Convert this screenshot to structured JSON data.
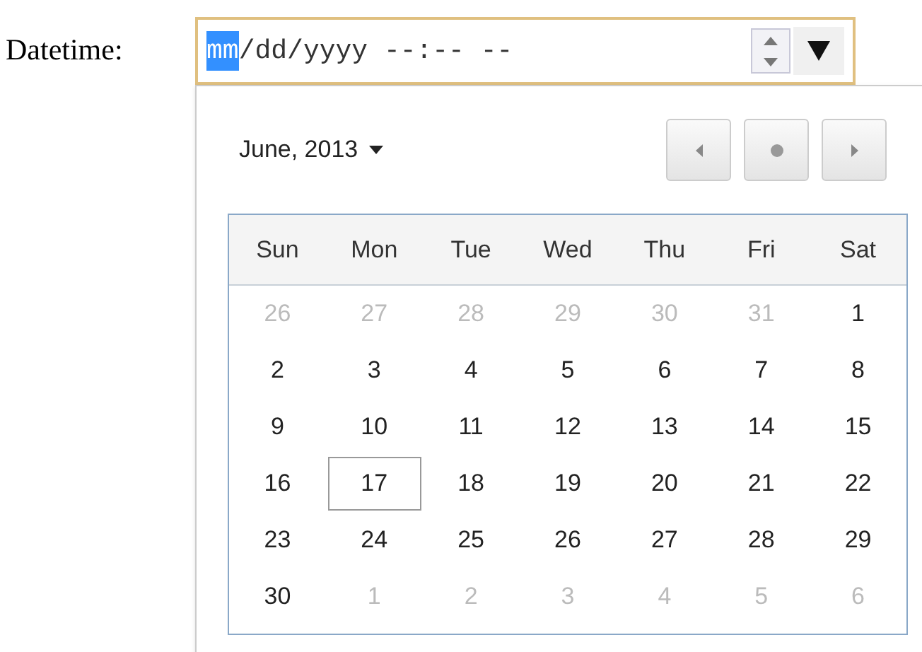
{
  "label": "Datetime:",
  "input": {
    "segments": [
      {
        "text": "mm",
        "selected": true
      },
      {
        "text": "/",
        "selected": false
      },
      {
        "text": "dd",
        "selected": false
      },
      {
        "text": "/",
        "selected": false
      },
      {
        "text": "yyyy",
        "selected": false
      },
      {
        "text": " --:--",
        "selected": false
      },
      {
        "text": " --",
        "selected": false
      }
    ]
  },
  "picker": {
    "month": "June, 2013",
    "weekdays": [
      "Sun",
      "Mon",
      "Tue",
      "Wed",
      "Thu",
      "Fri",
      "Sat"
    ],
    "weeks": [
      [
        {
          "day": "26",
          "outside": true,
          "focused": false
        },
        {
          "day": "27",
          "outside": true,
          "focused": false
        },
        {
          "day": "28",
          "outside": true,
          "focused": false
        },
        {
          "day": "29",
          "outside": true,
          "focused": false
        },
        {
          "day": "30",
          "outside": true,
          "focused": false
        },
        {
          "day": "31",
          "outside": true,
          "focused": false
        },
        {
          "day": "1",
          "outside": false,
          "focused": false
        }
      ],
      [
        {
          "day": "2",
          "outside": false,
          "focused": false
        },
        {
          "day": "3",
          "outside": false,
          "focused": false
        },
        {
          "day": "4",
          "outside": false,
          "focused": false
        },
        {
          "day": "5",
          "outside": false,
          "focused": false
        },
        {
          "day": "6",
          "outside": false,
          "focused": false
        },
        {
          "day": "7",
          "outside": false,
          "focused": false
        },
        {
          "day": "8",
          "outside": false,
          "focused": false
        }
      ],
      [
        {
          "day": "9",
          "outside": false,
          "focused": false
        },
        {
          "day": "10",
          "outside": false,
          "focused": false
        },
        {
          "day": "11",
          "outside": false,
          "focused": false
        },
        {
          "day": "12",
          "outside": false,
          "focused": false
        },
        {
          "day": "13",
          "outside": false,
          "focused": false
        },
        {
          "day": "14",
          "outside": false,
          "focused": false
        },
        {
          "day": "15",
          "outside": false,
          "focused": false
        }
      ],
      [
        {
          "day": "16",
          "outside": false,
          "focused": false
        },
        {
          "day": "17",
          "outside": false,
          "focused": true
        },
        {
          "day": "18",
          "outside": false,
          "focused": false
        },
        {
          "day": "19",
          "outside": false,
          "focused": false
        },
        {
          "day": "20",
          "outside": false,
          "focused": false
        },
        {
          "day": "21",
          "outside": false,
          "focused": false
        },
        {
          "day": "22",
          "outside": false,
          "focused": false
        }
      ],
      [
        {
          "day": "23",
          "outside": false,
          "focused": false
        },
        {
          "day": "24",
          "outside": false,
          "focused": false
        },
        {
          "day": "25",
          "outside": false,
          "focused": false
        },
        {
          "day": "26",
          "outside": false,
          "focused": false
        },
        {
          "day": "27",
          "outside": false,
          "focused": false
        },
        {
          "day": "28",
          "outside": false,
          "focused": false
        },
        {
          "day": "29",
          "outside": false,
          "focused": false
        }
      ],
      [
        {
          "day": "30",
          "outside": false,
          "focused": false
        },
        {
          "day": "1",
          "outside": true,
          "focused": false
        },
        {
          "day": "2",
          "outside": true,
          "focused": false
        },
        {
          "day": "3",
          "outside": true,
          "focused": false
        },
        {
          "day": "4",
          "outside": true,
          "focused": false
        },
        {
          "day": "5",
          "outside": true,
          "focused": false
        },
        {
          "day": "6",
          "outside": true,
          "focused": false
        }
      ]
    ]
  }
}
